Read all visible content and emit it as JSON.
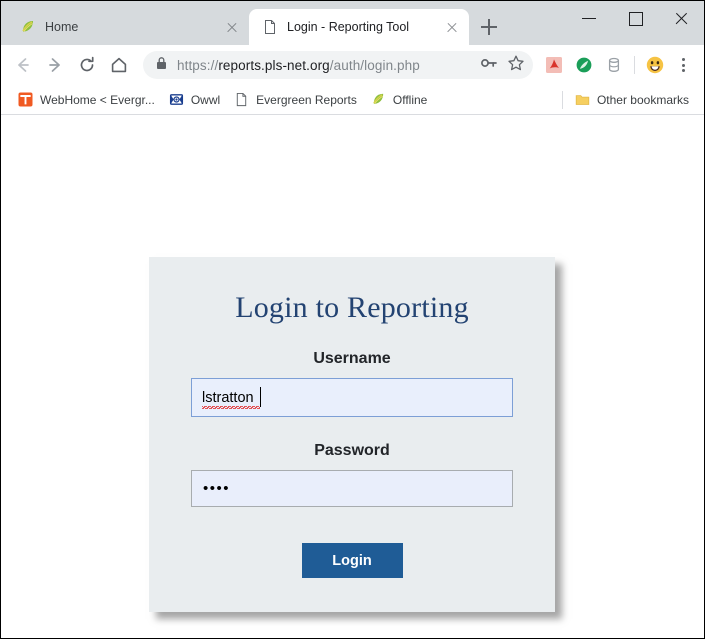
{
  "window": {
    "controls": {
      "minimize": "minimize-window",
      "maximize": "maximize-window",
      "close": "close-window"
    }
  },
  "tabs": [
    {
      "label": "Home",
      "favicon": "leaf-icon",
      "active": false
    },
    {
      "label": "Login - Reporting Tool",
      "favicon": "document-icon",
      "active": true
    }
  ],
  "newtab": {
    "label": "+",
    "name": "new-tab-button"
  },
  "toolbar": {
    "back": "back-icon",
    "forward": "forward-icon",
    "reload": "reload-icon",
    "home": "home-icon",
    "lock": "lock-icon",
    "url_scheme": "https://",
    "url_host": "reports.pls-net.org",
    "url_path": "/auth/login.php",
    "key_icon": "key-icon",
    "star_icon": "star-icon",
    "extensions": [
      {
        "name": "adobe-pdf-extension-icon",
        "color": "#e0604f"
      },
      {
        "name": "green-globe-extension-icon",
        "color": "#17a05a"
      },
      {
        "name": "database-extension-icon",
        "color": "#bdc1c6"
      }
    ],
    "profile_avatar": "emoji-avatar-icon",
    "menu": "kebab-menu-icon"
  },
  "bookmarks": {
    "items": [
      {
        "label": "WebHome < Evergr...",
        "icon": "orange-t-icon"
      },
      {
        "label": "Owwl",
        "icon": "owl-icon"
      },
      {
        "label": "Evergreen Reports",
        "icon": "document-icon"
      },
      {
        "label": "Offline",
        "icon": "leaf-icon"
      }
    ],
    "other": {
      "label": "Other bookmarks",
      "icon": "folder-icon"
    }
  },
  "login": {
    "title": "Login to Reporting",
    "username_label": "Username",
    "username_value": "lstratton",
    "username_placeholder": "",
    "password_label": "Password",
    "password_value": "••••",
    "password_placeholder": "",
    "submit_label": "Login"
  },
  "colors": {
    "card_bg": "#e9edef",
    "title_navy": "#234372",
    "button_blue": "#1f5c96",
    "focus_border": "#7d9fd6",
    "blur_border": "#a8acaf",
    "input_fill": "#e9effc",
    "spellcheck_red": "#e02020"
  }
}
